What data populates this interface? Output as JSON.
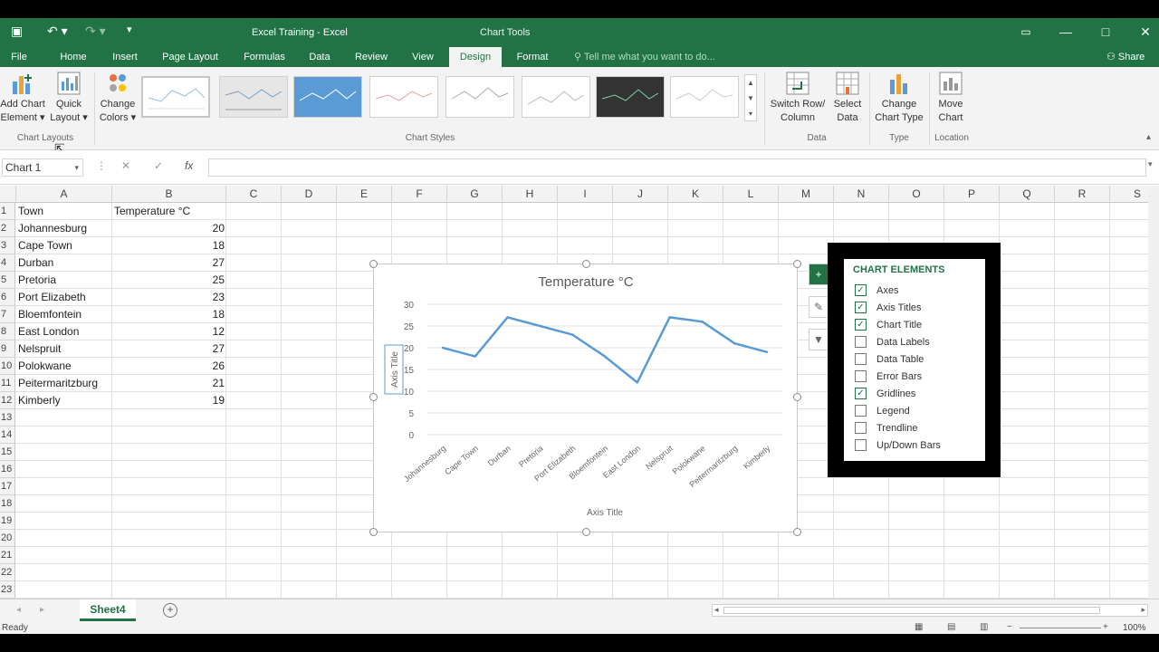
{
  "window": {
    "title": "Excel Training - Excel",
    "context_tab_group": "Chart Tools",
    "qat": {
      "save_icon": "save-icon",
      "undo_icon": "undo-icon",
      "redo_icon": "redo-icon",
      "customize_icon": "customize-qat-icon"
    },
    "controls": {
      "options": "▭",
      "minimize": "—",
      "restore": "□",
      "close": "✕"
    }
  },
  "tabs": [
    "File",
    "Home",
    "Insert",
    "Page Layout",
    "Formulas",
    "Data",
    "Review",
    "View",
    "Design",
    "Format"
  ],
  "active_tab": "Design",
  "tell_me": "Tell me what you want to do...",
  "share": "Share",
  "ribbon": {
    "add_chart_element": {
      "line1": "Add Chart",
      "line2": "Element ▾"
    },
    "quick_layout": {
      "line1": "Quick",
      "line2": "Layout ▾"
    },
    "change_colors": {
      "line1": "Change",
      "line2": "Colors ▾"
    },
    "switch_row_column": {
      "line1": "Switch Row/",
      "line2": "Column"
    },
    "select_data": {
      "line1": "Select",
      "line2": "Data"
    },
    "change_chart_type": {
      "line1": "Change",
      "line2": "Chart Type"
    },
    "move_chart": {
      "line1": "Move",
      "line2": "Chart"
    },
    "groups": {
      "chart_layouts": "Chart Layouts",
      "chart_styles": "Chart Styles",
      "data": "Data",
      "type": "Type",
      "location": "Location"
    }
  },
  "formula_bar": {
    "name_box": "Chart 1",
    "cancel": "✕",
    "enter": "✓",
    "fx": "fx",
    "value": ""
  },
  "columns": [
    "A",
    "B",
    "C",
    "D",
    "E",
    "F",
    "G",
    "H",
    "I",
    "J",
    "K",
    "L",
    "M",
    "N",
    "O",
    "P",
    "Q",
    "R",
    "S"
  ],
  "rows": [
    "1",
    "2",
    "3",
    "4",
    "5",
    "6",
    "7",
    "8",
    "9",
    "10",
    "11",
    "12",
    "13",
    "14",
    "15",
    "16",
    "17",
    "18",
    "19",
    "20",
    "21",
    "22",
    "23"
  ],
  "sheet": {
    "header": [
      "Town",
      "Temperature °C"
    ],
    "data": [
      [
        "Johannesburg",
        "20"
      ],
      [
        "Cape Town",
        "18"
      ],
      [
        "Durban",
        "27"
      ],
      [
        "Pretoria",
        "25"
      ],
      [
        "Port Elizabeth",
        "23"
      ],
      [
        "Bloemfontein",
        "18"
      ],
      [
        "East London",
        "12"
      ],
      [
        "Nelspruit",
        "27"
      ],
      [
        "Polokwane",
        "26"
      ],
      [
        "Peitermaritzburg",
        "21"
      ],
      [
        "Kimberly",
        "19"
      ]
    ]
  },
  "chart_data": {
    "type": "line",
    "title": "Temperature °C",
    "xlabel": "Axis Title",
    "ylabel": "Axis Title",
    "categories": [
      "Johannesburg",
      "Cape Town",
      "Durban",
      "Pretoria",
      "Port Elizabeth",
      "Bloemfontein",
      "East London",
      "Nelspruit",
      "Polokwane",
      "Peitermaritzburg",
      "Kimberly"
    ],
    "series": [
      {
        "values": [
          20,
          18,
          27,
          25,
          23,
          18,
          12,
          27,
          26,
          21,
          19
        ]
      }
    ],
    "ylim": [
      0,
      30
    ],
    "yticks": [
      "0",
      "5",
      "10",
      "15",
      "20",
      "25",
      "30"
    ],
    "grid": true,
    "legend": "none",
    "line_color": "#5b9bd5"
  },
  "chart_elements": {
    "title": "CHART ELEMENTS",
    "items": [
      {
        "label": "Axes",
        "checked": true
      },
      {
        "label": "Axis Titles",
        "checked": true
      },
      {
        "label": "Chart Title",
        "checked": true
      },
      {
        "label": "Data Labels",
        "checked": false
      },
      {
        "label": "Data Table",
        "checked": false
      },
      {
        "label": "Error Bars",
        "checked": false
      },
      {
        "label": "Gridlines",
        "checked": true
      },
      {
        "label": "Legend",
        "checked": false
      },
      {
        "label": "Trendline",
        "checked": false
      },
      {
        "label": "Up/Down Bars",
        "checked": false
      }
    ]
  },
  "chart_side_buttons": {
    "elements": "+",
    "styles": "✎",
    "filters": "▼"
  },
  "sheet_tab": "Sheet4",
  "add_sheet": "+",
  "status": "Ready",
  "zoom": "100%",
  "accent": "#217346"
}
